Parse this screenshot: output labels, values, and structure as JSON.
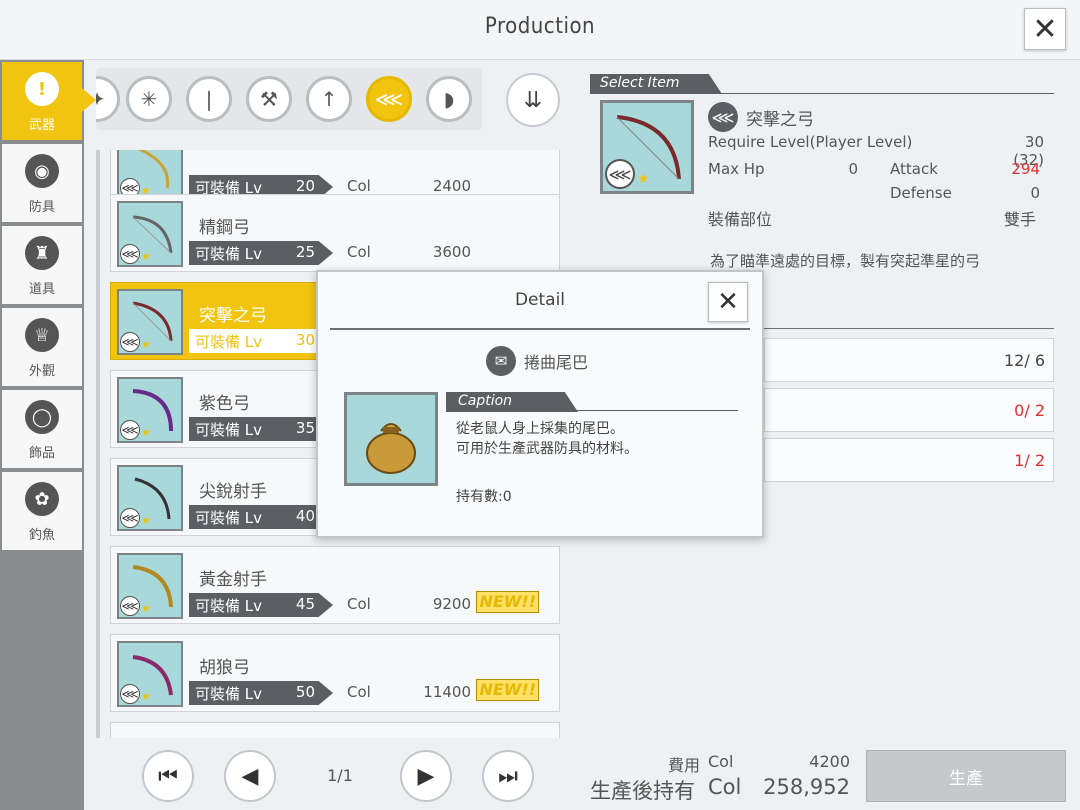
{
  "header": {
    "title": "Production",
    "close": "✕"
  },
  "categories": [
    {
      "label": "武器",
      "icon": "!"
    },
    {
      "label": "防具",
      "icon": "◉"
    },
    {
      "label": "道具",
      "icon": "♜"
    },
    {
      "label": "外觀",
      "icon": "♕"
    },
    {
      "label": "飾品",
      "icon": "◯"
    },
    {
      "label": "釣魚",
      "icon": "✿"
    }
  ],
  "type_icons": [
    "✦",
    "✳",
    "❘",
    "⚒",
    "↑",
    "⋘",
    "◗"
  ],
  "sort_icon": "⇊",
  "list": {
    "level_label": "可裝備 Lv",
    "col_label": "Col",
    "new_label": "NEW!!",
    "items": [
      {
        "name": "",
        "level": "20",
        "col": "2400",
        "new": false
      },
      {
        "name": "精鋼弓",
        "level": "25",
        "col": "3600",
        "new": false
      },
      {
        "name": "突擊之弓",
        "level": "30",
        "col": "",
        "new": false,
        "selected": true
      },
      {
        "name": "紫色弓",
        "level": "35",
        "col": "",
        "new": false
      },
      {
        "name": "尖銳射手",
        "level": "40",
        "col": "",
        "new": false
      },
      {
        "name": "黃金射手",
        "level": "45",
        "col": "9200",
        "new": true
      },
      {
        "name": "胡狼弓",
        "level": "50",
        "col": "11400",
        "new": true
      }
    ]
  },
  "pager": {
    "first": "⏮",
    "prev": "◀",
    "page": "1/1",
    "next": "▶",
    "last": "⏭"
  },
  "select_item": {
    "tab": "Select Item",
    "name": "突擊之弓",
    "require_label": "Require Level(Player Level)",
    "require_value": "30 (32)",
    "maxhp_label": "Max Hp",
    "maxhp_value": "0",
    "attack_label": "Attack",
    "attack_value": "294",
    "defense_label": "Defense",
    "defense_value": "0",
    "slot_label": "裝備部位",
    "slot_value": "雙手",
    "description": "為了瞄準遠處的目標，製有突起準星的弓"
  },
  "materials": [
    {
      "count": "12/ 6",
      "lack": false
    },
    {
      "count": "0/ 2",
      "lack": true
    },
    {
      "count": "1/ 2",
      "lack": true
    }
  ],
  "cost": {
    "fee_label": "費用",
    "fee_col": "Col",
    "fee_value": "4200",
    "after_label": "生產後持有",
    "after_col": "Col",
    "after_value": "258,952",
    "produce_button": "生產"
  },
  "modal": {
    "title": "Detail",
    "close": "✕",
    "item_name": "捲曲尾巴",
    "caption_tab": "Caption",
    "caption_line1": "從老鼠人身上採集的尾巴。",
    "caption_line2": "可用於生產武器防具的材料。",
    "owned": "持有數:0"
  },
  "colors": {
    "accent": "#f1c40f",
    "alert": "#e03030",
    "dark": "#5b5f63"
  }
}
